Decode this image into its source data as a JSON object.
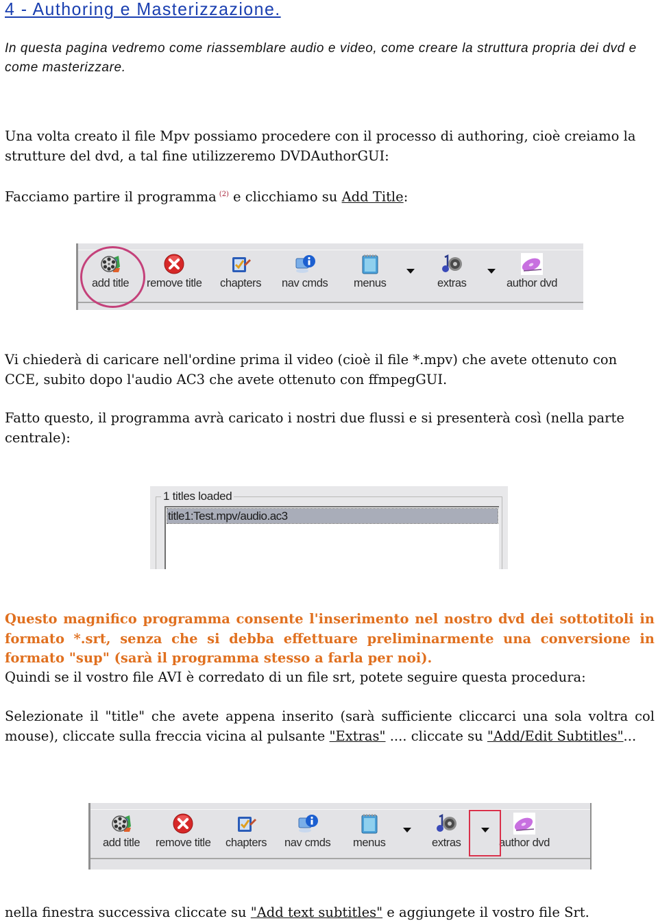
{
  "heading": "4 - Authoring e Masterizzazione.",
  "intro": "In questa pagina vedremo come riassemblare audio e video, come creare la struttura propria dei dvd e come masterizzare.",
  "paragraphs": {
    "p1": "Una volta creato il file Mpv possiamo procedere con il processo di authoring, cioè creiamo la strutture del dvd, a tal fine utilizzeremo DVDAuthorGUI:",
    "p2": {
      "before": "Facciamo partire il programma",
      "footnote": "(2)",
      "middle": "e clicchiamo su",
      "link": "Add Title",
      "after": ":"
    },
    "p3": "Vi chiederà di caricare nell'ordine prima il video (cioè il file *.mpv) che avete ottenuto con CCE, subito dopo l'audio AC3 che avete ottenuto con ffmpegGUI.",
    "p4": "Fatto questo, il programma avrà caricato i nostri due flussi e si presenterà così (nella parte centrale):",
    "highlight": "Questo magnifico programma consente l'inserimento nel nostro dvd dei sottotitoli in formato *.srt, senza che si debba effettuare preliminarmente una conversione in formato \"sup\" (sarà il programma stesso a farla per noi).",
    "p5": "Quindi se il vostro file AVI è corredato di un file srt, potete seguire questa procedura:",
    "p6": {
      "before": "Selezionate il \"title\" che avete appena inserito (sarà sufficiente cliccarci una sola voltra col mouse), cliccate sulla freccia vicina al pulsante",
      "link1": "\"Extras\"",
      "middle": ".... cliccate su",
      "link2": "\"Add/Edit Subtitles\"",
      "after": "..."
    },
    "p7": {
      "before": "nella finestra successiva cliccate su",
      "link": "\"Add text subtitles\"",
      "after": "e aggiungete il vostro file Srt."
    }
  },
  "toolbar": {
    "buttons": [
      {
        "label": "add title",
        "icon": "film-reel-icon"
      },
      {
        "label": "remove title",
        "icon": "red-x-icon"
      },
      {
        "label": "chapters",
        "icon": "checklist-icon"
      },
      {
        "label": "nav cmds",
        "icon": "info-computer-icon"
      },
      {
        "label": "menus",
        "icon": "notepad-icon"
      },
      {
        "label": "extras",
        "icon": "music-speaker-icon"
      },
      {
        "label": "author dvd",
        "icon": "disc-icon"
      }
    ],
    "highlight_color_circle": "#c4417a",
    "highlight_color_rect": "#d9304a"
  },
  "titles_list": {
    "group_label": "1 titles loaded",
    "items": [
      "title1:Test.mpv/audio.ac3"
    ]
  },
  "colors": {
    "heading": "#1a3fb0",
    "highlight_text": "#e0701f",
    "footnote": "#a8243a"
  }
}
